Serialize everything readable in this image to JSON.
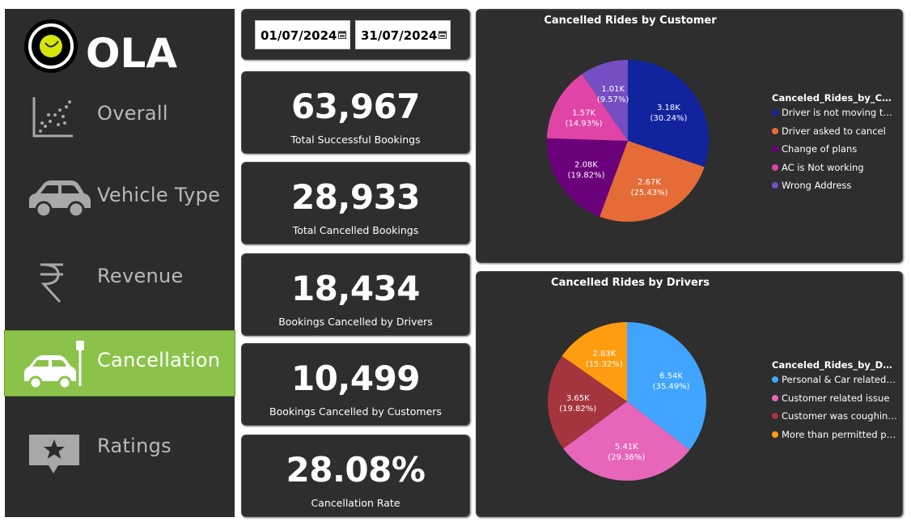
{
  "brand": {
    "name": "OLA"
  },
  "sidebar": {
    "items": [
      {
        "label": "Overall",
        "icon": "scatter-plot-icon",
        "active": false
      },
      {
        "label": "Vehicle Type",
        "icon": "car-icon",
        "active": false
      },
      {
        "label": "Revenue",
        "icon": "rupee-icon",
        "active": false
      },
      {
        "label": "Cancellation",
        "icon": "car-cancellation-icon",
        "active": true
      },
      {
        "label": "Ratings",
        "icon": "star-rating-icon",
        "active": false
      }
    ]
  },
  "filters": {
    "start_date": "01/07/2024",
    "end_date": "31/07/2024"
  },
  "kpis": [
    {
      "value": "63,967",
      "label": "Total Successful Bookings"
    },
    {
      "value": "28,933",
      "label": "Total Cancelled Bookings"
    },
    {
      "value": "18,434",
      "label": "Bookings Cancelled by Drivers"
    },
    {
      "value": "10,499",
      "label": "Bookings Cancelled by Customers"
    },
    {
      "value": "28.08%",
      "label": "Cancellation Rate"
    }
  ],
  "colors": {
    "sidebar_bg": "#2c2c2c",
    "active_bg": "#8bc34a",
    "card_bg": "#2e2e2e"
  },
  "chart_data": [
    {
      "type": "pie",
      "title": "Cancelled Rides by Customer",
      "legend_title": "Canceled_Rides_by_Custo...",
      "legend_placement": "right",
      "slices": [
        {
          "name": "Driver is not moving to...",
          "value_label": "3.18K",
          "pct_label": "(30.24%)",
          "percent": 30.24,
          "color": "#12239e"
        },
        {
          "name": "Driver asked to cancel",
          "value_label": "2.67K",
          "pct_label": "(25.43%)",
          "percent": 25.43,
          "color": "#e66c37"
        },
        {
          "name": "Change of plans",
          "value_label": "2.08K",
          "pct_label": "(19.82%)",
          "percent": 19.82,
          "color": "#6b007b"
        },
        {
          "name": "AC is Not working",
          "value_label": "1.57K",
          "pct_label": "(14.93%)",
          "percent": 14.93,
          "color": "#e044a7"
        },
        {
          "name": "Wrong Address",
          "value_label": "1.01K",
          "pct_label": "(9.57%)",
          "percent": 9.57,
          "color": "#744ec2"
        }
      ]
    },
    {
      "type": "pie",
      "title": "Cancelled Rides by Drivers",
      "legend_title": "Canceled_Rides_by_Driver",
      "legend_placement": "right",
      "slices": [
        {
          "name": "Personal & Car related i...",
          "value_label": "6.54K",
          "pct_label": "(35.49%)",
          "percent": 35.49,
          "color": "#41a4ff"
        },
        {
          "name": "Customer related issue",
          "value_label": "5.41K",
          "pct_label": "(29.36%)",
          "percent": 29.36,
          "color": "#e766b9"
        },
        {
          "name": "Customer was coughing...",
          "value_label": "3.65K",
          "pct_label": "(19.82%)",
          "percent": 19.82,
          "color": "#a4343e"
        },
        {
          "name": "More than permitted pe...",
          "value_label": "2.83K",
          "pct_label": "(15.32%)",
          "percent": 15.32,
          "color": "#ff9c0f"
        }
      ]
    }
  ]
}
